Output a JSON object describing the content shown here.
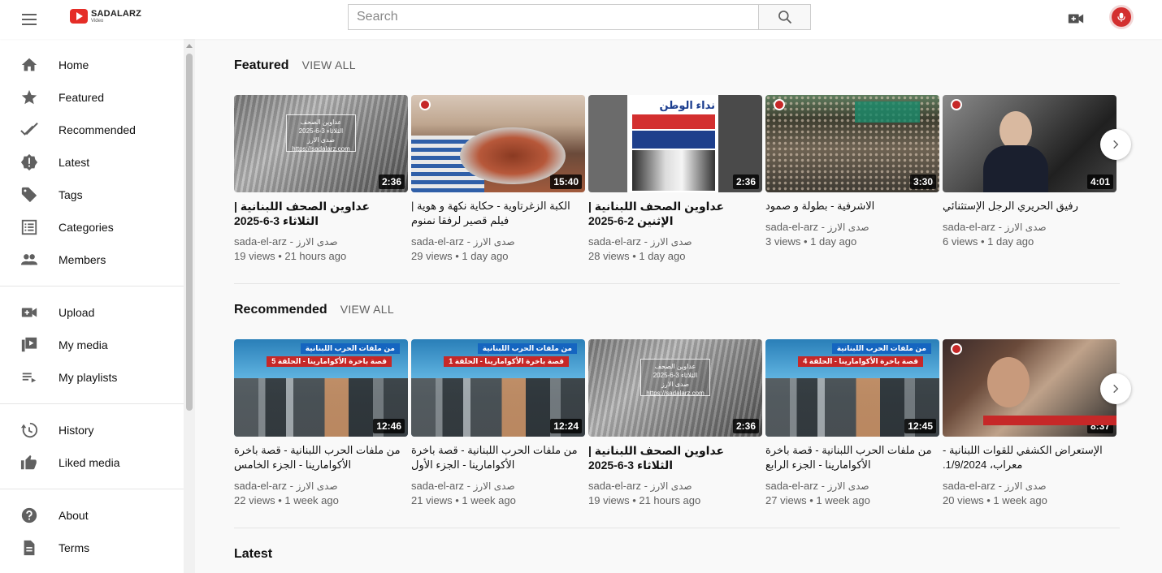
{
  "header": {
    "logo_name": "SADALARZ",
    "logo_sub": "Video",
    "search_placeholder": "Search"
  },
  "sidebar": {
    "sections": [
      [
        {
          "label": "Home",
          "icon": "home-icon"
        },
        {
          "label": "Featured",
          "icon": "star-icon"
        },
        {
          "label": "Recommended",
          "icon": "double-check-icon"
        },
        {
          "label": "Latest",
          "icon": "badge-alert-icon"
        },
        {
          "label": "Tags",
          "icon": "tag-icon"
        },
        {
          "label": "Categories",
          "icon": "list-icon"
        },
        {
          "label": "Members",
          "icon": "people-icon"
        }
      ],
      [
        {
          "label": "Upload",
          "icon": "video-plus-icon"
        },
        {
          "label": "My media",
          "icon": "media-icon"
        },
        {
          "label": "My playlists",
          "icon": "playlist-icon"
        }
      ],
      [
        {
          "label": "History",
          "icon": "history-icon"
        },
        {
          "label": "Liked media",
          "icon": "thumb-up-icon"
        }
      ],
      [
        {
          "label": "About",
          "icon": "help-icon"
        },
        {
          "label": "Terms",
          "icon": "document-icon"
        }
      ]
    ]
  },
  "sections": {
    "featured": {
      "title": "Featured",
      "view_all": "VIEW ALL",
      "videos": [
        {
          "title": "عداوين الصحف اللبنانية | الثلاثاء 3-6-2025",
          "channel": "sada-el-arz",
          "channel_ar": "صدى الارز",
          "views": "19 views",
          "age": "21 hours ago",
          "duration": "2:36",
          "thumb_text": "عداوين الصحف\nالثلاثاء 3-6-2025\nصدى الارز\nhttps://sadalarz.com"
        },
        {
          "title": "الكبة الزغرتاوية - حكاية نكهة و هوية | فيلم قصير لرفقا نمنوم",
          "channel": "sada-el-arz",
          "channel_ar": "صدى الارز",
          "views": "29 views",
          "age": "1 day ago",
          "duration": "15:40"
        },
        {
          "title": "عداوين الصحف اللبنانية | الإثنين 2-6-2025",
          "channel": "sada-el-arz",
          "channel_ar": "صدى الارز",
          "views": "28 views",
          "age": "1 day ago",
          "duration": "2:36",
          "thumb_text": "نداء الوطن"
        },
        {
          "title": "الاشرفية - بطولة و صمود",
          "channel": "sada-el-arz",
          "channel_ar": "صدى الارز",
          "views": "3 views",
          "age": "1 day ago",
          "duration": "3:30"
        },
        {
          "title": "رفيق الحريري الرجل الإستثنائي",
          "channel": "sada-el-arz",
          "channel_ar": "صدى الارز",
          "views": "6 views",
          "age": "1 day ago",
          "duration": "4:01"
        }
      ]
    },
    "recommended": {
      "title": "Recommended",
      "view_all": "VIEW ALL",
      "videos": [
        {
          "title": "من ملفات الحرب اللبنانية - قصة باخرة الأكوامارينا - الجزء الخامس",
          "channel": "sada-el-arz",
          "channel_ar": "صدى الارز",
          "views": "22 views",
          "age": "1 week ago",
          "duration": "12:46",
          "thumb_top": "من ملفات الحرب اللبنانية",
          "thumb_sub": "قصة باخرة الأكوامارينا - الحلقة 5"
        },
        {
          "title": "من ملفات الحرب اللبنانية - قصة باخرة الأكوامارينا - الجزء الأول",
          "channel": "sada-el-arz",
          "channel_ar": "صدى الارز",
          "views": "21 views",
          "age": "1 week ago",
          "duration": "12:24",
          "thumb_top": "من ملفات الحرب اللبنانية",
          "thumb_sub": "قصة باخرة الأكوامارينا - الحلقة 1"
        },
        {
          "title": "عداوين الصحف اللبنانية | الثلاثاء 3-6-2025",
          "channel": "sada-el-arz",
          "channel_ar": "صدى الارز",
          "views": "19 views",
          "age": "21 hours ago",
          "duration": "2:36",
          "thumb_text": "عداوين الصحف\nالثلاثاء 3-6-2025\nصدى الارز\nhttps://sadalarz.com"
        },
        {
          "title": "من ملفات الحرب اللبنانية - قصة باخرة الأكوامارينا - الجزء الرابع",
          "channel": "sada-el-arz",
          "channel_ar": "صدى الارز",
          "views": "27 views",
          "age": "1 week ago",
          "duration": "12:45",
          "thumb_top": "من ملفات الحرب اللبنانية",
          "thumb_sub": "قصة باخرة الأكوامارينا - الحلقة 4"
        },
        {
          "title": "الإستعراض الكشفي للقوات اللبنانية - معراب، 1/9/2024.",
          "channel": "sada-el-arz",
          "channel_ar": "صدى الارز",
          "views": "20 views",
          "age": "1 week ago",
          "duration": "8:37"
        }
      ]
    },
    "latest": {
      "title": "Latest"
    }
  },
  "colors": {
    "brand_red": "#e52d27",
    "text_primary": "#111111",
    "text_secondary": "#606060"
  }
}
